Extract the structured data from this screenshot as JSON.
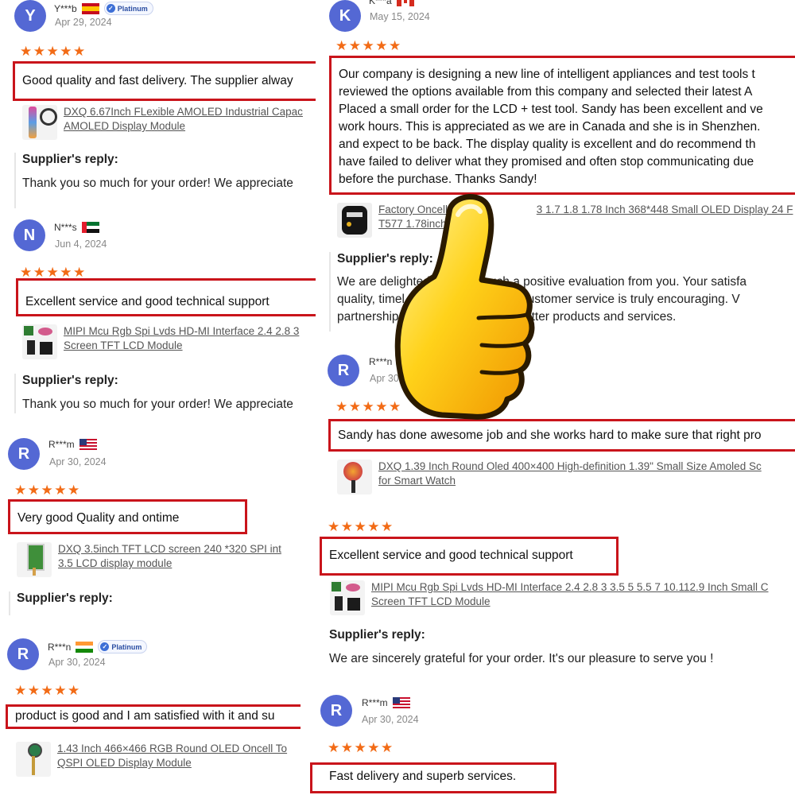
{
  "stars": "★★★★★",
  "reply_title": "Supplier's reply:",
  "colors": {
    "avatar": "#5468d4",
    "star": "#f26b16",
    "highlight_border": "#c9141b",
    "link": "#555555"
  },
  "reviews": [
    {
      "initial": "Y",
      "user": "Y***b",
      "flag": "spain",
      "badge": "Platinum",
      "date": "Apr 29, 2024",
      "text": [
        "Good quality and fast delivery. The supplier alway"
      ],
      "product": [
        "DXQ 6.67Inch FLexible AMOLED Industrial Capac",
        "AMOLED Display Module"
      ],
      "reply": "Thank you so much for your order! We appreciate"
    },
    {
      "initial": "N",
      "user": "N***s",
      "flag": "uae",
      "date": "Jun 4, 2024",
      "text": [
        "Excellent service and good technical support"
      ],
      "product": [
        "MIPI Mcu Rgb Spi Lvds HD-MI Interface 2.4 2.8 3",
        "Screen TFT LCD Module"
      ],
      "reply": "Thank you so much for your order! We appreciate"
    },
    {
      "initial": "R",
      "user": "R***m",
      "flag": "usa",
      "date": "Apr 30, 2024",
      "text": [
        "Very good Quality and ontime"
      ],
      "product": [
        "DXQ 3.5inch TFT LCD screen 240 *320 SPI int",
        "3.5 LCD display module"
      ]
    },
    {
      "initial": "R",
      "user": "R***n",
      "flag": "india",
      "badge": "Platinum",
      "date": "Apr 30, 2024",
      "text": [
        "product is good and I am satisfied with it and su"
      ],
      "product": [
        "1.43 Inch 466×466 RGB Round OLED Oncell To",
        "QSPI OLED Display Module"
      ]
    },
    {
      "initial": "K",
      "user": "K***a",
      "flag": "canada",
      "date": "May 15, 2024",
      "text": [
        "Our company is designing a new line of intelligent appliances and test tools t",
        "reviewed the options available from this company and selected their latest A",
        "Placed a small order for the LCD + test tool. Sandy has been excellent and ve",
        "work hours. This is appreciated as we are in Canada and she is in Shenzhen.",
        "and expect to be back. The display quality is excellent and do recommend th",
        "have failed to deliver what they promised and often stop communicating due",
        "before the purchase. Thanks Sandy!"
      ],
      "product": [
        "Factory Oncell T",
        "3 1.7 1.8 1.78 Inch 368*448 Small OLED Display 24 F",
        "T577 1.78inch"
      ],
      "reply_lines": [
        "We are delighted to",
        "such a positive evaluation from you. Your satisfa",
        "quality, timel",
        "attentive customer service is truly encouraging. V",
        "partnership",
        "with even better products and services."
      ]
    },
    {
      "initial": "R",
      "user": "R***n",
      "date": "Apr 30",
      "text": [
        "Sandy has done awesome job and she works hard to make sure that right pro"
      ],
      "product": [
        "DXQ 1.39 Inch Round Oled 400×400 High-definition 1.39\" Small Size Amoled Sc",
        "for Smart Watch"
      ]
    },
    {
      "text": [
        "Excellent service and good technical support"
      ],
      "product": [
        "MIPI Mcu Rgb Spi Lvds HD-MI Interface 2.4 2.8 3 3.5 5 5.5 7 10.112.9 Inch Small C",
        "Screen TFT LCD Module"
      ],
      "reply": "We are sincerely grateful for your order. It's our pleasure to serve you !"
    },
    {
      "initial": "R",
      "user": "R***m",
      "flag": "usa",
      "date": "Apr 30, 2024",
      "text": [
        "Fast delivery and superb services."
      ]
    }
  ]
}
